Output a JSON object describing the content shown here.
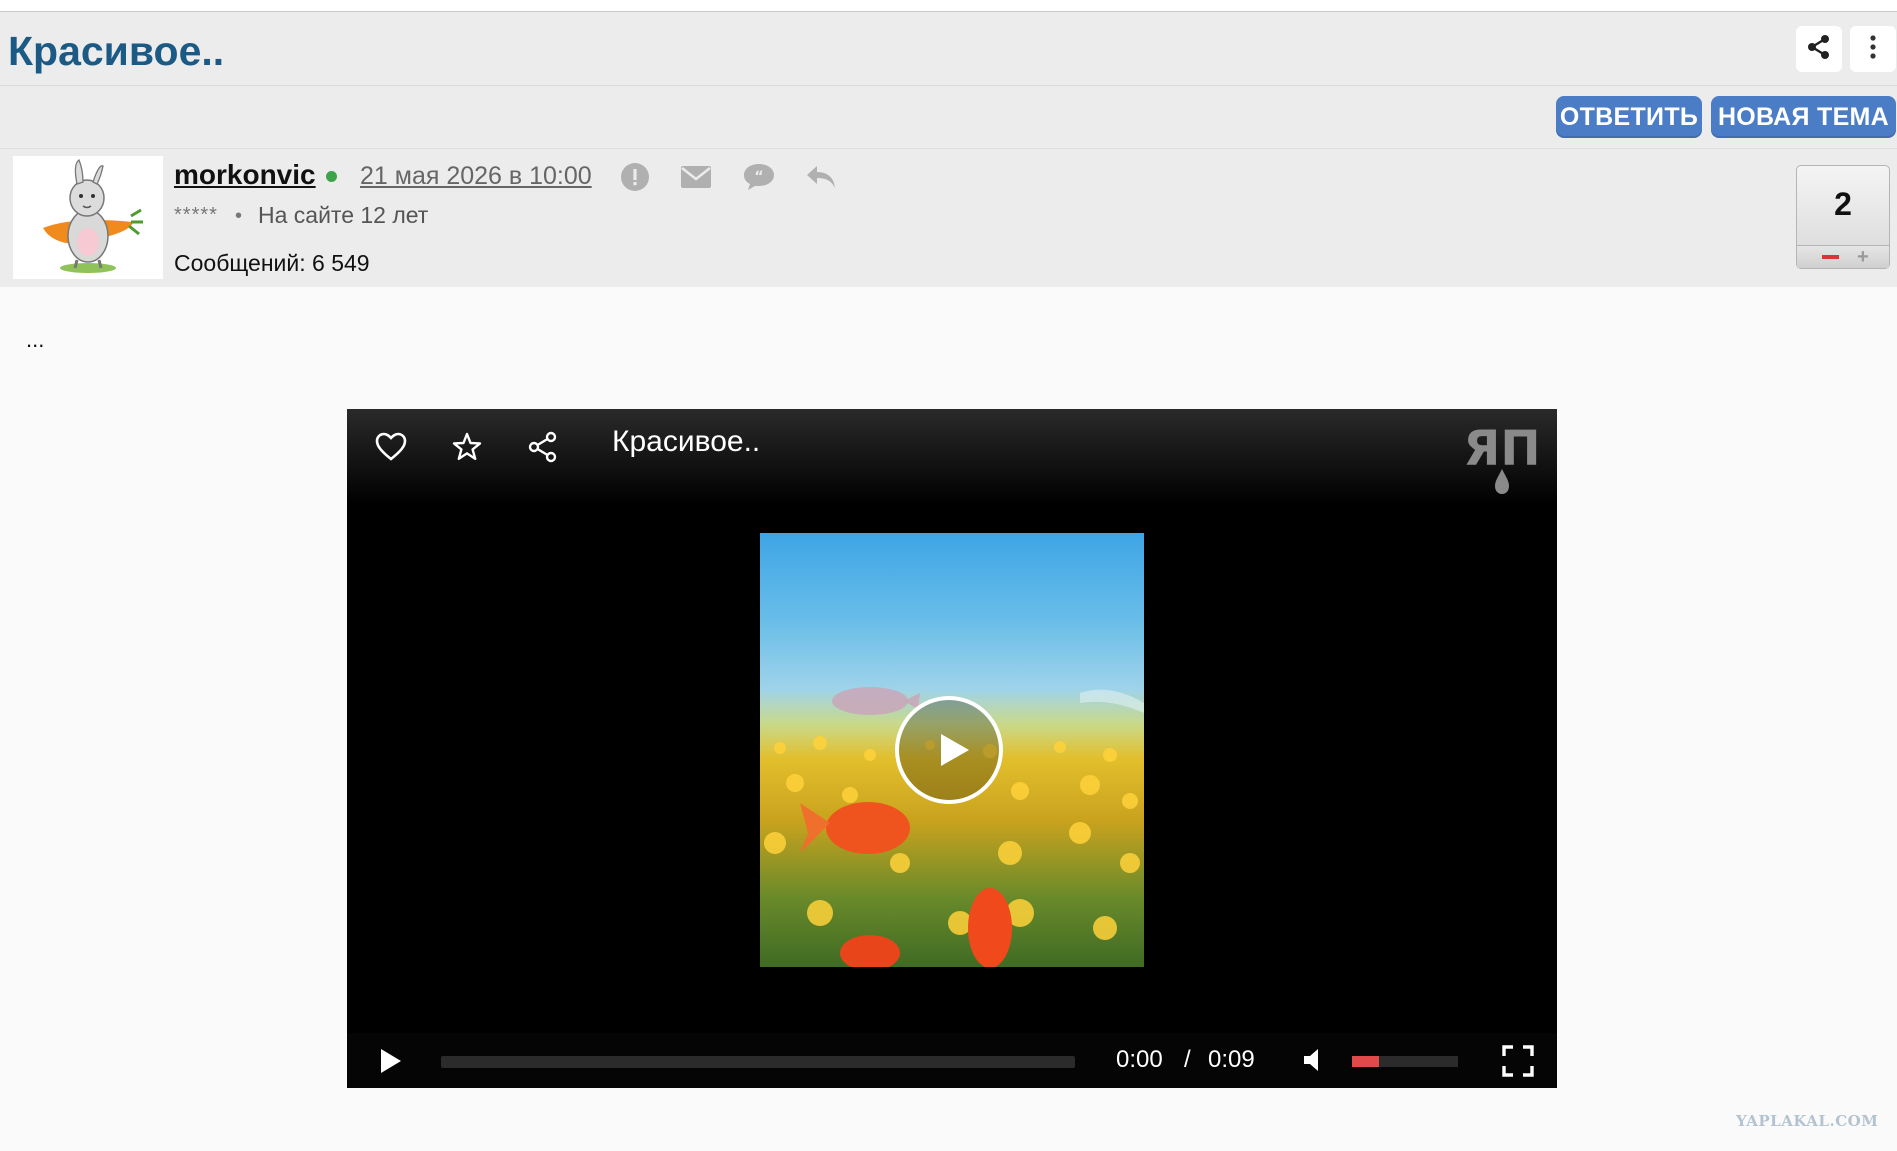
{
  "topic": {
    "title": "Красивое..",
    "reply_label": "ОТВЕТИТЬ",
    "new_topic_label": "НОВАЯ ТЕМА"
  },
  "post": {
    "username": "morkonvic",
    "date": "21 мая 2026 в 10:00",
    "stars": "*****",
    "bullet": "•",
    "on_site": "На сайте 12 лет",
    "messages_label": "Сообщений:",
    "messages_count": "6 549",
    "rating": "2",
    "text": "..."
  },
  "player": {
    "title": "Красивое..",
    "current_time": "0:00",
    "separator": "/",
    "duration": "0:09",
    "progress": 0,
    "volume": 0.25,
    "logo_text": "ЯП"
  },
  "watermark": "YAPLAKAL.COM",
  "colors": {
    "title": "#1c5a86",
    "button": "#4b7cc6",
    "online": "#3ea34a",
    "volume": "#e24a4a"
  },
  "icons": [
    "share-icon",
    "more-vertical-icon",
    "report-icon",
    "mail-icon",
    "quote-icon",
    "reply-icon",
    "heart-icon",
    "star-icon",
    "share-icon",
    "play-icon",
    "volume-icon",
    "fullscreen-icon"
  ]
}
